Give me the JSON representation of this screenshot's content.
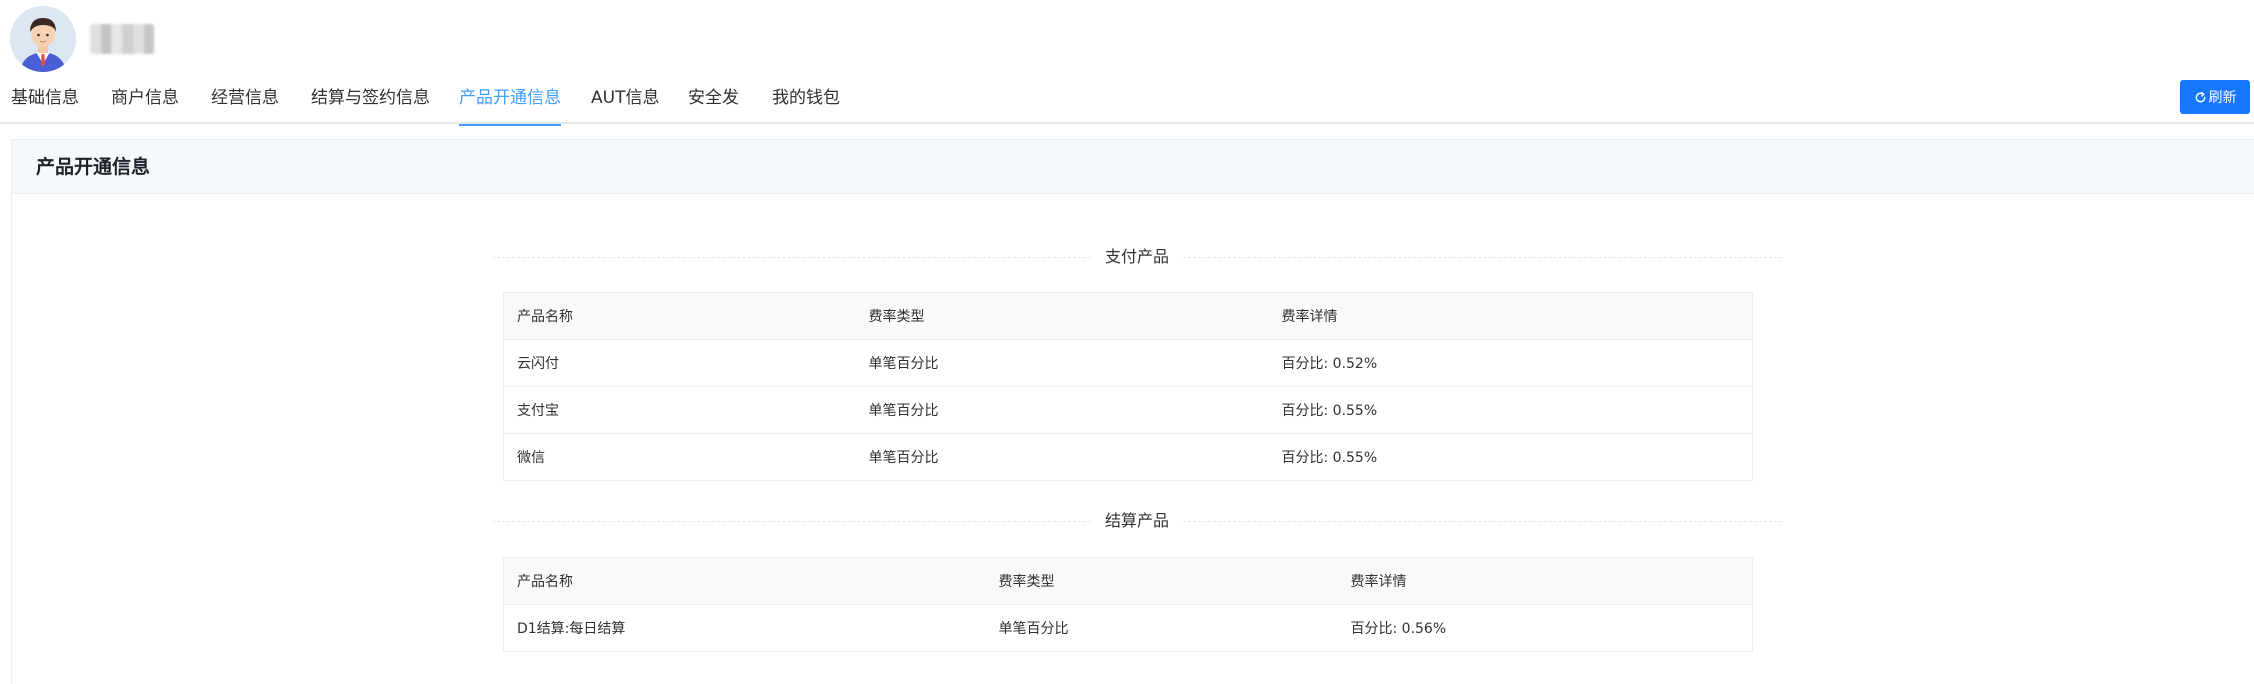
{
  "user": {
    "avatar_icon": "user-avatar-icon"
  },
  "tabs": [
    {
      "label": "基础信息",
      "active": false
    },
    {
      "label": "商户信息",
      "active": false
    },
    {
      "label": "经营信息",
      "active": false
    },
    {
      "label": "结算与签约信息",
      "active": false
    },
    {
      "label": "产品开通信息",
      "active": true
    },
    {
      "label": "AUT信息",
      "active": false
    },
    {
      "label": "安全发",
      "active": false
    },
    {
      "label": "我的钱包",
      "active": false
    }
  ],
  "toolbar": {
    "refresh_label": "刷新",
    "refresh_icon": "refresh-icon"
  },
  "card": {
    "title": "产品开通信息"
  },
  "payment_section": {
    "title": "支付产品",
    "columns": [
      "产品名称",
      "费率类型",
      "费率详情"
    ],
    "rows": [
      [
        "云闪付",
        "单笔百分比",
        "百分比: 0.52%"
      ],
      [
        "支付宝",
        "单笔百分比",
        "百分比: 0.55%"
      ],
      [
        "微信",
        "单笔百分比",
        "百分比: 0.55%"
      ]
    ]
  },
  "settlement_section": {
    "title": "结算产品",
    "columns": [
      "产品名称",
      "费率类型",
      "费率详情"
    ],
    "rows": [
      [
        "D1结算:每日结算",
        "单笔百分比",
        "百分比: 0.56%"
      ]
    ]
  },
  "colors": {
    "accent": "#409eff",
    "button": "#1677ff",
    "header_bg": "#f5f9fd"
  }
}
